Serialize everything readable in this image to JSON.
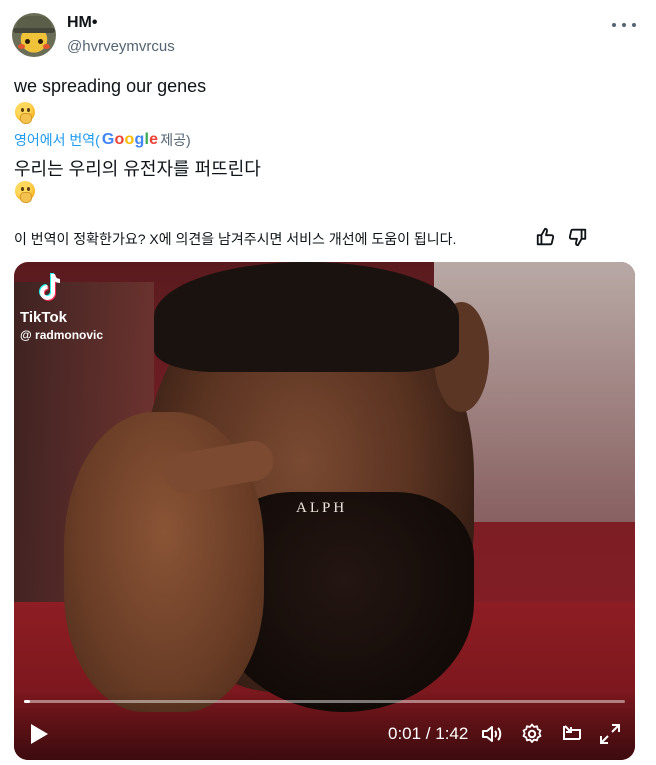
{
  "user": {
    "name": "HM•",
    "handle": "@hvrveymvrcus",
    "avatar_icon": "pikachu-hat-avatar"
  },
  "tweet": {
    "text": "we spreading our genes",
    "emoji": "shushing-face-emoji"
  },
  "translation": {
    "from_label": "영어에서 번역(",
    "provider_g1": "G",
    "provider_o1": "o",
    "provider_o2": "o",
    "provider_g2": "g",
    "provider_l": "l",
    "provider_e": "e",
    "provider_suffix": " 제공)",
    "text": "우리는 우리의 유전자를 퍼뜨린다",
    "emoji": "shushing-face-emoji"
  },
  "feedback": {
    "text": "이 번역이 정확한가요? X에 의견을 남겨주시면 서비스 개선에 도움이 됩니다.",
    "like_icon": "thumbs-up-icon",
    "dislike_icon": "thumbs-down-icon"
  },
  "video": {
    "tiktok_label": "TikTok",
    "tiktok_user": "@ radmonovic",
    "watermark": "ALPH",
    "time": "0:01 / 1:42",
    "progress": 0.01,
    "icons": [
      "play-icon",
      "volume-icon",
      "settings-icon",
      "pip-icon",
      "fullscreen-icon"
    ]
  },
  "colors": {
    "link": "#1d9bf0",
    "secondary_text": "#536471"
  }
}
